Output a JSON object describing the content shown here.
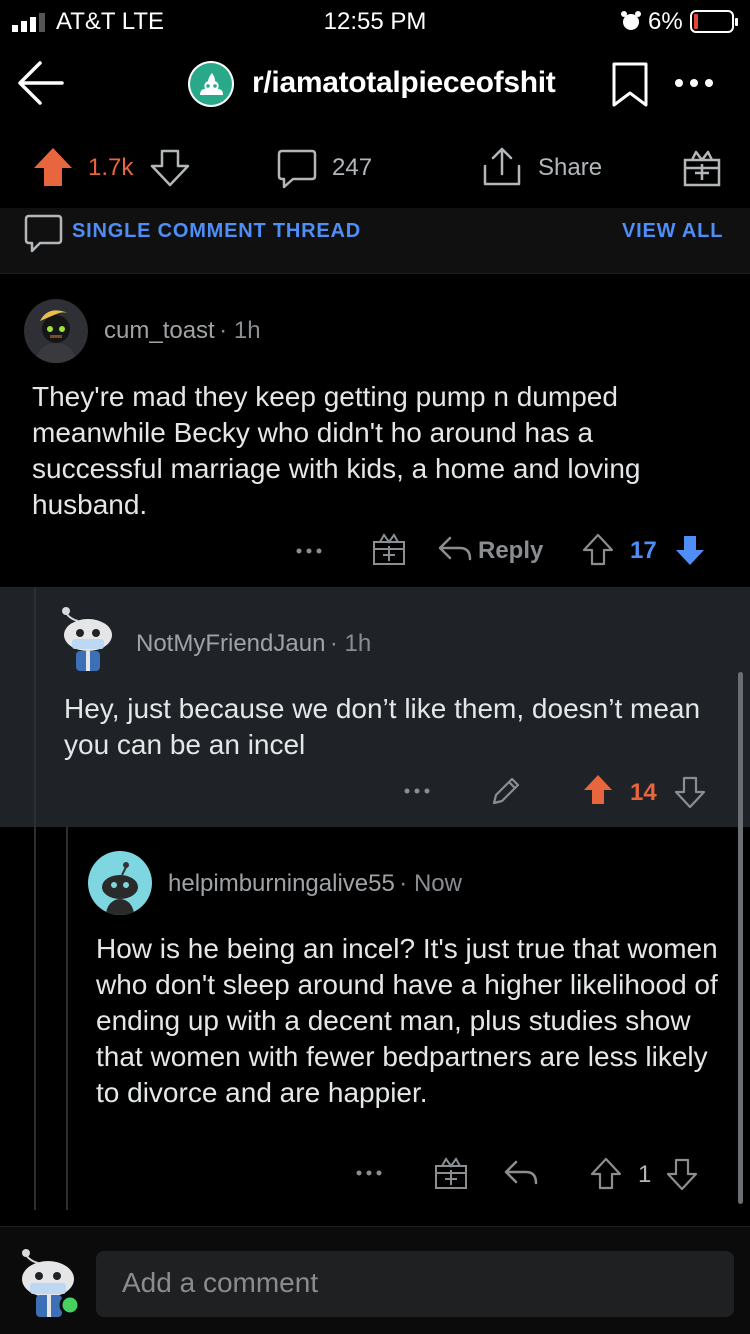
{
  "status": {
    "carrier": "AT&T  LTE",
    "time": "12:55 PM",
    "battery": "6%"
  },
  "header": {
    "subreddit": "r/iamatotalpieceofshit"
  },
  "post_actions": {
    "upvotes": "1.7k",
    "comments": "247",
    "share_label": "Share"
  },
  "thread_bar": {
    "label": "SINGLE COMMENT THREAD",
    "view_all": "VIEW ALL"
  },
  "comments": [
    {
      "user": "cum_toast",
      "time": "1h",
      "body": "They're mad they keep getting pump n dumped meanwhile Becky who didn't ho around has a successful marriage with kids, a home and loving husband.",
      "reply_label": "Reply",
      "score": "17",
      "vote_state": "downvoted"
    },
    {
      "user": "NotMyFriendJaun",
      "time": "1h",
      "body": "Hey, just because we don’t like them, doesn’t mean you can be an incel",
      "score": "14",
      "vote_state": "upvoted"
    },
    {
      "user": "helpimburningalive55",
      "time": "Now",
      "body": "How is he being an incel? It's just true that women who don't sleep around have a higher likelihood of ending up with a decent man, plus studies show that women with fewer bedpartners are less likely to divorce and are happier.",
      "score": "1",
      "vote_state": "none"
    }
  ],
  "composer": {
    "placeholder": "Add a comment"
  },
  "colors": {
    "upvote": "#e8663d",
    "downvote": "#4f8ef7",
    "accent_blue": "#4f8ef7",
    "nested_bg": "#1f2227"
  }
}
